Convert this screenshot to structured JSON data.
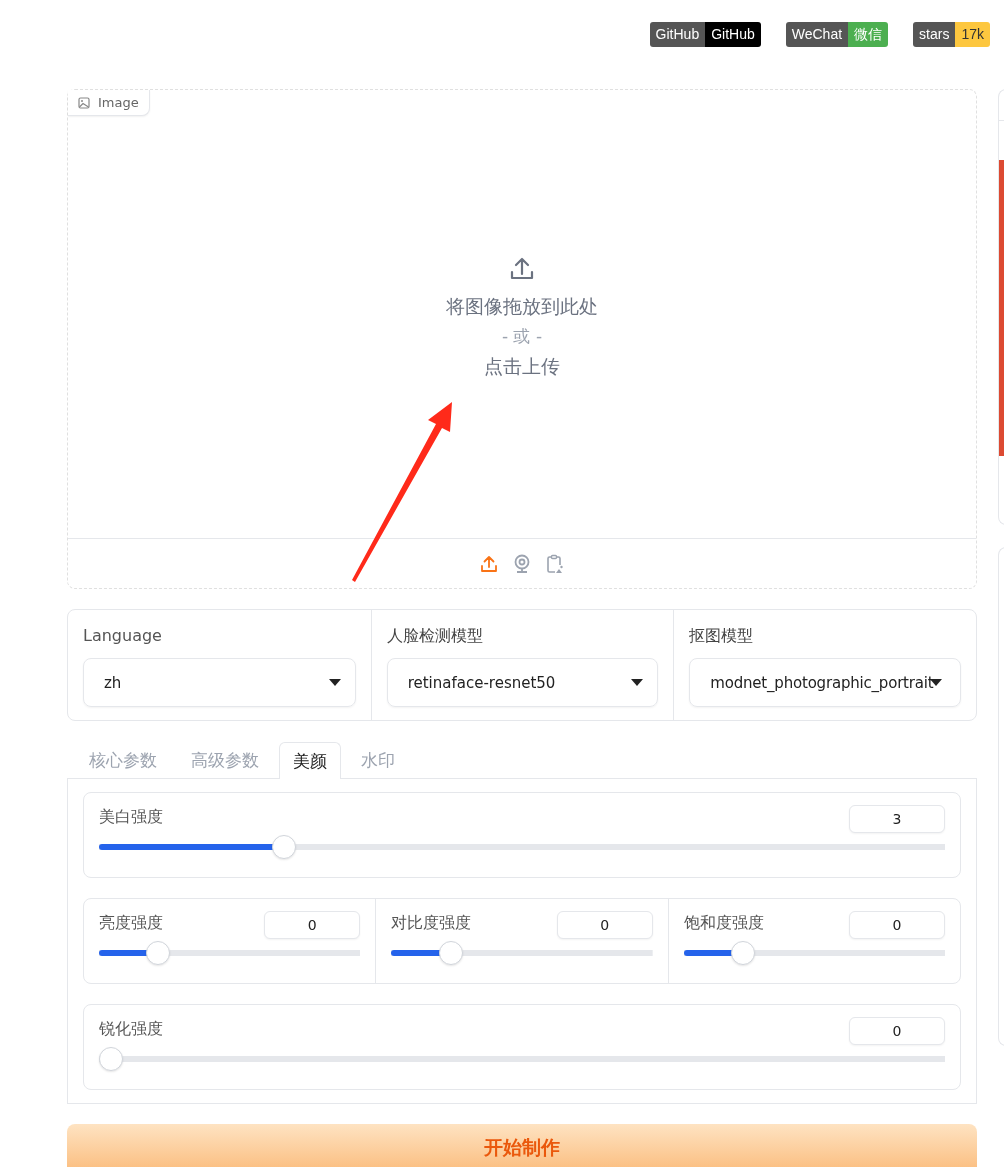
{
  "badges": [
    {
      "label": "GitHub",
      "value": "GitHub",
      "color": "#000000"
    },
    {
      "label": "WeChat",
      "value": "微信",
      "color": "#4caf50"
    },
    {
      "label": "stars",
      "value": "17k",
      "color": "#fdc73f"
    }
  ],
  "image_upload": {
    "label": "Image",
    "drop_text": "将图像拖放到此处",
    "or_text": "- 或 -",
    "click_text": "点击上传",
    "sources": [
      {
        "kind": "upload",
        "selected": true
      },
      {
        "kind": "webcam",
        "selected": false
      },
      {
        "kind": "clipboard",
        "selected": false
      }
    ]
  },
  "dropdowns": [
    {
      "label": "Language",
      "value": "zh"
    },
    {
      "label": "人脸检测模型",
      "value": "retinaface-resnet50"
    },
    {
      "label": "抠图模型",
      "value": "modnet_photographic_portrait"
    }
  ],
  "tabs": [
    {
      "label": "核心参数",
      "selected": false
    },
    {
      "label": "高级参数",
      "selected": false
    },
    {
      "label": "美颜",
      "selected": true
    },
    {
      "label": "水印",
      "selected": false
    }
  ],
  "slider_rows": [
    {
      "sliders": [
        {
          "label": "美白强度",
          "value": "3",
          "level": 0.21
        }
      ]
    },
    {
      "sliders": [
        {
          "label": "亮度强度",
          "value": "0",
          "level": 0.2
        },
        {
          "label": "对比度强度",
          "value": "0",
          "level": 0.2
        },
        {
          "label": "饱和度强度",
          "value": "0",
          "level": 0.2
        }
      ]
    },
    {
      "sliders": [
        {
          "label": "锐化强度",
          "value": "0",
          "level": 0
        }
      ]
    }
  ],
  "submit_button": "开始制作"
}
